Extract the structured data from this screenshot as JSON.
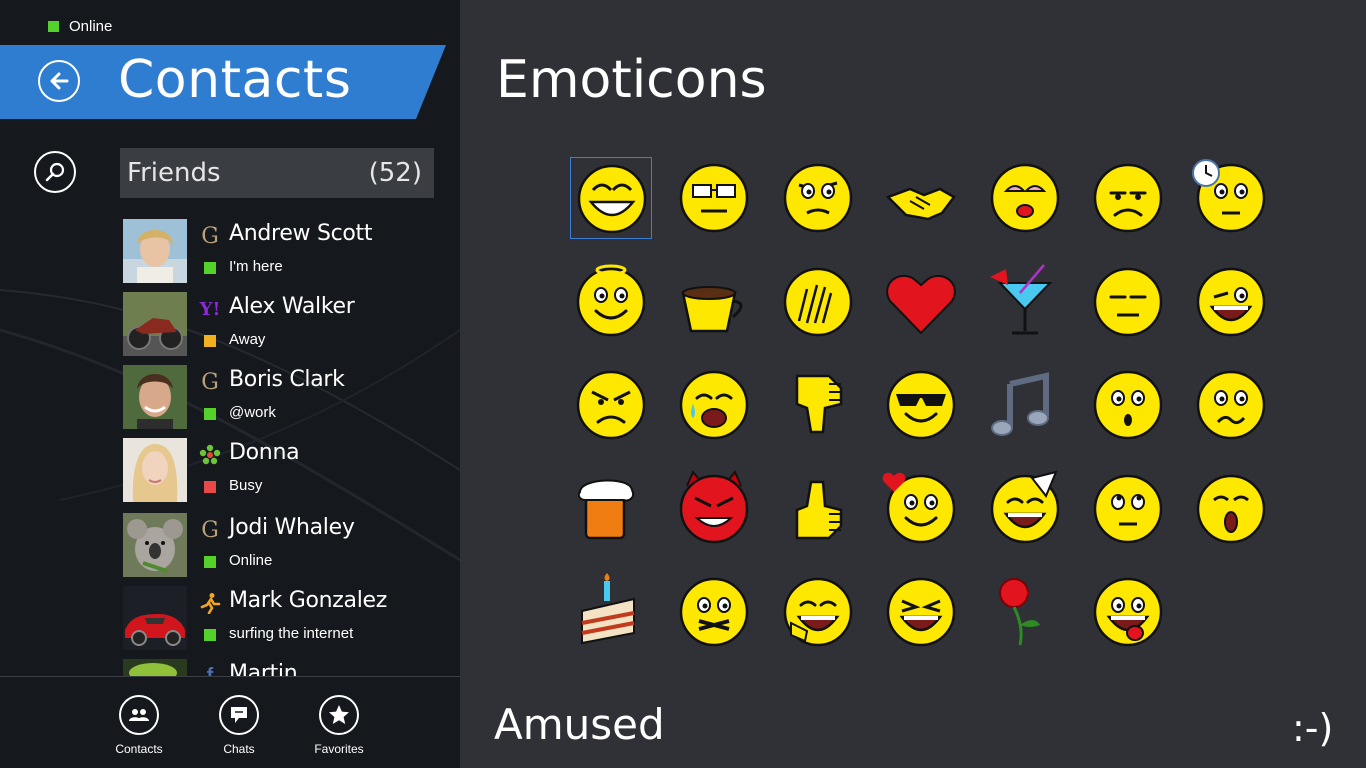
{
  "status": {
    "label": "Online",
    "color": "#55d12b"
  },
  "header": {
    "title": "Contacts",
    "accent": "#2f7dd1"
  },
  "group": {
    "name": "Friends",
    "count": "(52)"
  },
  "contacts": [
    {
      "name": "Andrew Scott",
      "status": "I'm here",
      "network": "google",
      "status_color": "#55d12b"
    },
    {
      "name": "Alex Walker",
      "status": "Away",
      "network": "yahoo",
      "status_color": "#f2b01e"
    },
    {
      "name": "Boris Clark",
      "status": "@work",
      "network": "google",
      "status_color": "#55d12b"
    },
    {
      "name": "Donna",
      "status": "Busy",
      "network": "icq",
      "status_color": "#e8484a"
    },
    {
      "name": "Jodi Whaley",
      "status": "Online",
      "network": "google",
      "status_color": "#55d12b"
    },
    {
      "name": "Mark Gonzalez",
      "status": "surfing the internet",
      "network": "aim",
      "status_color": "#55d12b"
    },
    {
      "name": "Martin",
      "status": "",
      "network": "facebook",
      "status_color": "#55d12b"
    }
  ],
  "appbar": {
    "contacts": "Contacts",
    "chats": "Chats",
    "favorites": "Favorites"
  },
  "emoticons_panel": {
    "title": "Emoticons",
    "selected_name": "Amused",
    "selected_code": ":-)",
    "grid": [
      [
        "amused",
        "nerd",
        "skeptical",
        "handshake",
        "kiss",
        "sad",
        "waiting"
      ],
      [
        "angel",
        "coffee",
        "facepalm",
        "heart",
        "cocktail",
        "sleepy",
        "wink"
      ],
      [
        "angry",
        "crying",
        "thumbs-down",
        "cool",
        "music",
        "surprised",
        "worried"
      ],
      [
        "beer",
        "devil",
        "thumbs-up",
        "in-love",
        "party",
        "rolling-eyes",
        "shocked"
      ],
      [
        "cake",
        "mouth-shut",
        "giggle",
        "laugh",
        "rose",
        "tongue"
      ]
    ]
  }
}
